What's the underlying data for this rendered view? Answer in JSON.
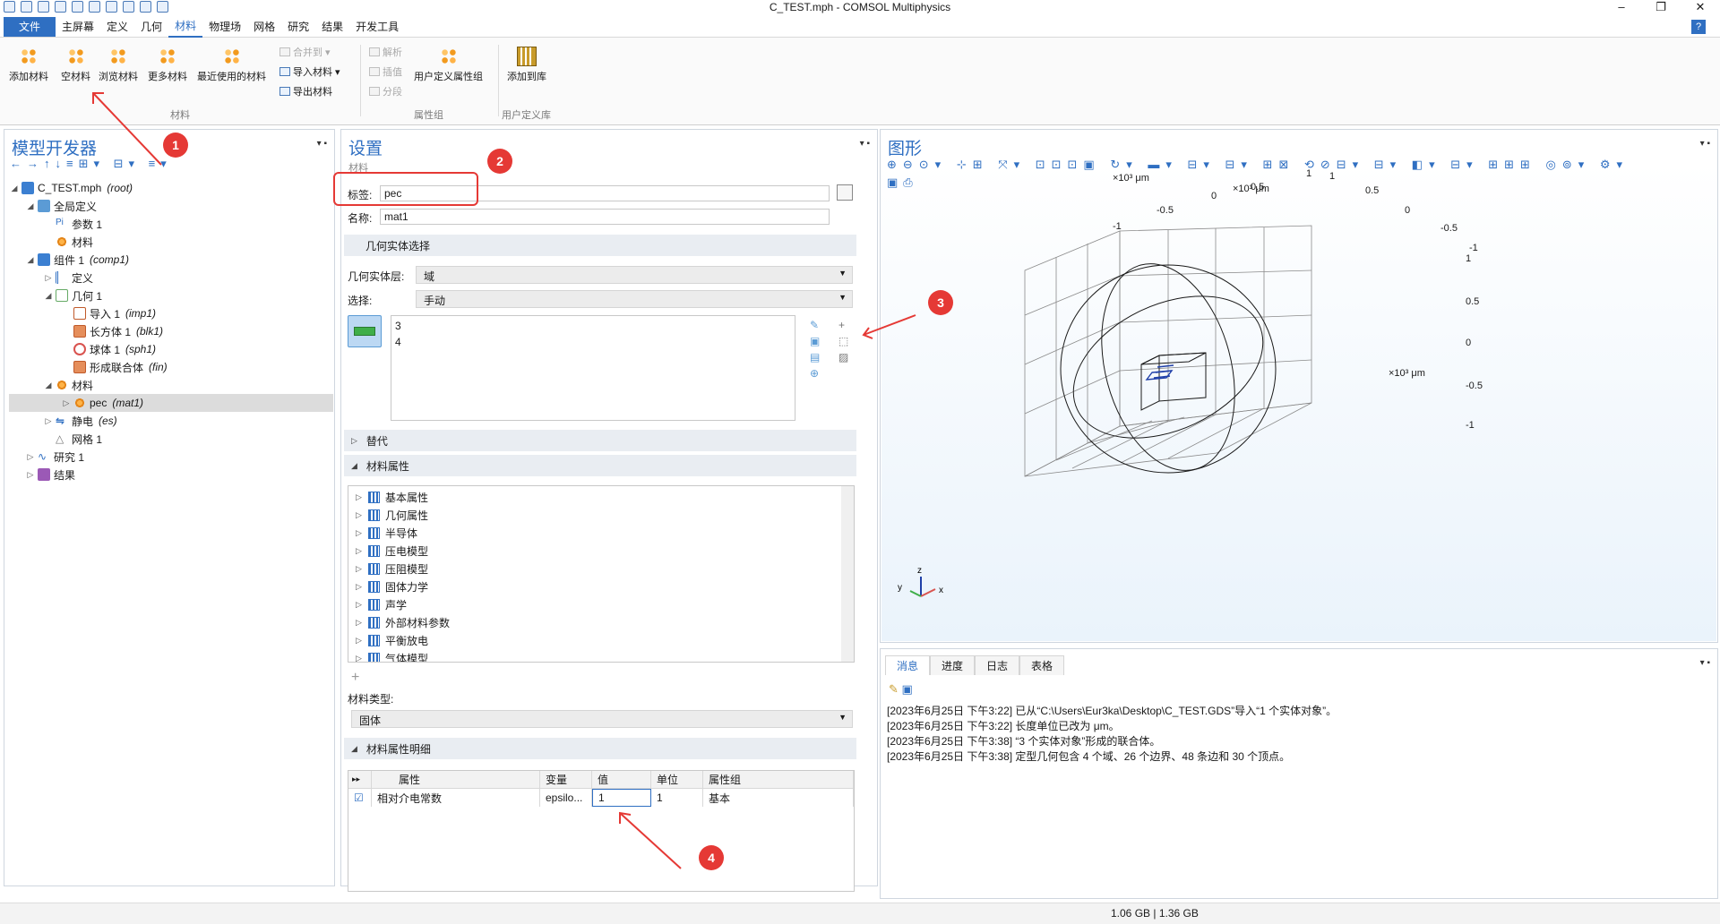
{
  "window": {
    "title": "C_TEST.mph - COMSOL Multiphysics",
    "controls": [
      "‒",
      "❐",
      "✕"
    ]
  },
  "menu": {
    "file": "文件",
    "items": [
      "主屏幕",
      "定义",
      "几何",
      "材料",
      "物理场",
      "网格",
      "研究",
      "结果",
      "开发工具"
    ],
    "active_index": 3,
    "help": "?"
  },
  "ribbon": {
    "buttons": [
      "添加材料",
      "空材料",
      "浏览材料",
      "更多材料",
      "最近使用的材料"
    ],
    "small": [
      "合并到 ▾",
      "导入材料 ▾",
      "导出材料"
    ],
    "analysis": [
      "解析",
      "插值",
      "分段"
    ],
    "user_group_btn": "用户定义属性组",
    "add_to_lib": "添加到库",
    "groups": [
      "材料",
      "属性组",
      "用户定义库"
    ]
  },
  "model_builder": {
    "title": "模型开发器",
    "tree": [
      {
        "label": "C_TEST.mph",
        "tag": "(root)"
      },
      {
        "label": "全局定义",
        "tag": ""
      },
      {
        "label": "参数 1",
        "tag": ""
      },
      {
        "label": "材料",
        "tag": ""
      },
      {
        "label": "组件 1",
        "tag": "(comp1)"
      },
      {
        "label": "定义",
        "tag": ""
      },
      {
        "label": "几何 1",
        "tag": ""
      },
      {
        "label": "导入 1",
        "tag": "(imp1)"
      },
      {
        "label": "长方体 1",
        "tag": "(blk1)"
      },
      {
        "label": "球体 1",
        "tag": "(sph1)"
      },
      {
        "label": "形成联合体",
        "tag": "(fin)"
      },
      {
        "label": "材料",
        "tag": ""
      },
      {
        "label": "pec",
        "tag": "(mat1)"
      },
      {
        "label": "静电",
        "tag": "(es)"
      },
      {
        "label": "网格 1",
        "tag": ""
      },
      {
        "label": "研究 1",
        "tag": ""
      },
      {
        "label": "结果",
        "tag": ""
      }
    ]
  },
  "settings": {
    "title": "设置",
    "subtitle": "材料",
    "label_caption": "标签:",
    "label_value": "pec",
    "name_caption": "名称:",
    "name_value": "mat1",
    "geom_section": "几何实体选择",
    "geom_level_caption": "几何实体层:",
    "geom_level_value": "域",
    "selection_caption": "选择:",
    "selection_value": "手动",
    "selection_items": [
      "3",
      "4"
    ],
    "override_section": "替代",
    "props_section": "材料属性",
    "props": [
      "基本属性",
      "几何属性",
      "半导体",
      "压电模型",
      "压阻模型",
      "固体力学",
      "声学",
      "外部材料参数",
      "平衡放电",
      "气体模型"
    ],
    "mat_type_caption": "材料类型:",
    "mat_type_value": "固体",
    "contents_section": "材料属性明细",
    "table_headers": [
      "属性",
      "变量",
      "值",
      "单位",
      "属性组"
    ],
    "table_row": [
      "相对介电常数",
      "epsilo...",
      "1",
      "1",
      "基本"
    ]
  },
  "graphics": {
    "title": "图形",
    "axis_labels": {
      "top_left_unit": "×10³ μm",
      "top_right_unit": "×10³ μm",
      "right_unit": "×10³ μm"
    },
    "ticks_top_left": [
      "-1",
      "-0.5",
      "0",
      "0.5",
      "1"
    ],
    "ticks_top_right": [
      "1",
      "0.5",
      "0",
      "-0.5",
      "-1"
    ],
    "ticks_right": [
      "1",
      "0.5",
      "0",
      "-0.5",
      "-1"
    ],
    "triad": [
      "z",
      "y",
      "x"
    ]
  },
  "messages": {
    "tabs": [
      "消息",
      "进度",
      "日志",
      "表格"
    ],
    "lines": [
      "[2023年6月25日 下午3:22] 已从“C:\\Users\\Eur3ka\\Desktop\\C_TEST.GDS”导入“1 个实体对象”。",
      "[2023年6月25日 下午3:22] 长度单位已改为 μm。",
      "[2023年6月25日 下午3:38] “3 个实体对象”形成的联合体。",
      "[2023年6月25日 下午3:38] 定型几何包含 4 个域、26 个边界、48 条边和 30 个顶点。"
    ]
  },
  "status": {
    "memory": "1.06 GB | 1.36 GB"
  },
  "annotations": [
    "1",
    "2",
    "3",
    "4"
  ],
  "colors": {
    "accent": "#2f6fc2",
    "annotation": "#e53935"
  }
}
